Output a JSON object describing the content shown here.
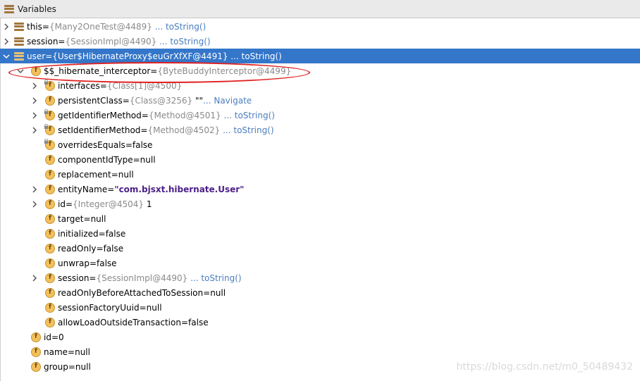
{
  "panel": {
    "title": "Variables"
  },
  "rows": [
    {
      "name": "this",
      "type": "{Many2OneTest@4489}",
      "link": "... toString()"
    },
    {
      "name": "session",
      "type": "{SessionImpl@4490}",
      "link": "... toString()"
    },
    {
      "name": "user",
      "type": "{User$HibernateProxy$euGrXfXF@4491}",
      "link": "... toString()"
    },
    {
      "name": "$$_hibernate_interceptor",
      "type": "{ByteBuddyInterceptor@4499}"
    },
    {
      "name": "interfaces",
      "type": "{Class[1]@4500}"
    },
    {
      "name": "persistentClass",
      "type": "{Class@3256}",
      "value": "\"\"",
      "link": "... Navigate"
    },
    {
      "name": "getIdentifierMethod",
      "type": "{Method@4501}",
      "link": "... toString()"
    },
    {
      "name": "setIdentifierMethod",
      "type": "{Method@4502}",
      "link": "... toString()"
    },
    {
      "name": "overridesEquals",
      "value": "false"
    },
    {
      "name": "componentIdType",
      "value": "null"
    },
    {
      "name": "replacement",
      "value": "null"
    },
    {
      "name": "entityName",
      "value": "\"com.bjsxt.hibernate.User\""
    },
    {
      "name": "id",
      "type": "{Integer@4504}",
      "value": "1"
    },
    {
      "name": "target",
      "value": "null"
    },
    {
      "name": "initialized",
      "value": "false"
    },
    {
      "name": "readOnly",
      "value": "false"
    },
    {
      "name": "unwrap",
      "value": "false"
    },
    {
      "name": "session",
      "type": "{SessionImpl@4490}",
      "link": "... toString()"
    },
    {
      "name": "readOnlyBeforeAttachedToSession",
      "value": "null"
    },
    {
      "name": "sessionFactoryUuid",
      "value": "null"
    },
    {
      "name": "allowLoadOutsideTransaction",
      "value": "false"
    },
    {
      "name": "id",
      "value": "0"
    },
    {
      "name": "name",
      "value": "null"
    },
    {
      "name": "group",
      "value": "null"
    }
  ],
  "eq": " = ",
  "field_icon_letter": "f",
  "watermark": "https://blog.csdn.net/m0_50489432",
  "colors": {
    "selection": "#3476c9",
    "highlight_ellipse": "#e02020",
    "field_icon": "#f3c05c",
    "link": "#4a7ec0"
  }
}
